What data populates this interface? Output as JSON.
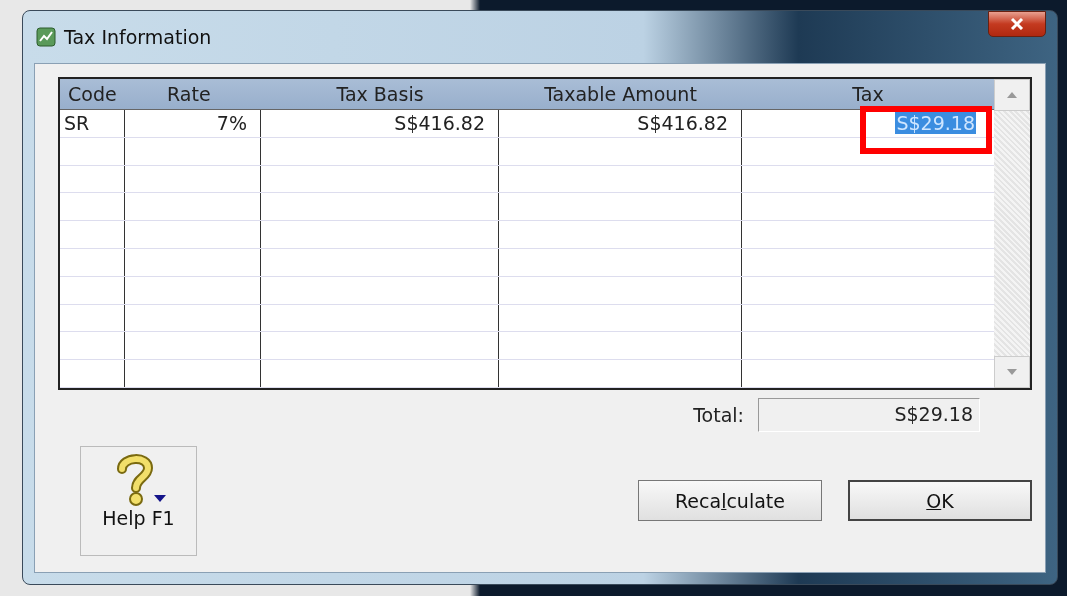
{
  "window": {
    "title": "Tax Information"
  },
  "table": {
    "columns": [
      "Code",
      "Rate",
      "Tax Basis",
      "Taxable Amount",
      "Tax"
    ],
    "rows": [
      {
        "code": "SR",
        "rate": "7%",
        "tax_basis": "S$416.82",
        "taxable_amount": "S$416.82",
        "tax": "S$29.18",
        "tax_selected": true,
        "tax_highlighted": true
      }
    ]
  },
  "total": {
    "label": "Total:",
    "value": "S$29.18"
  },
  "help_button": {
    "label": "Help F1"
  },
  "buttons": [
    {
      "before": "Reca",
      "key": "l",
      "after": "culate",
      "default": false
    },
    {
      "key": "O",
      "after": "K",
      "default": true
    }
  ]
}
